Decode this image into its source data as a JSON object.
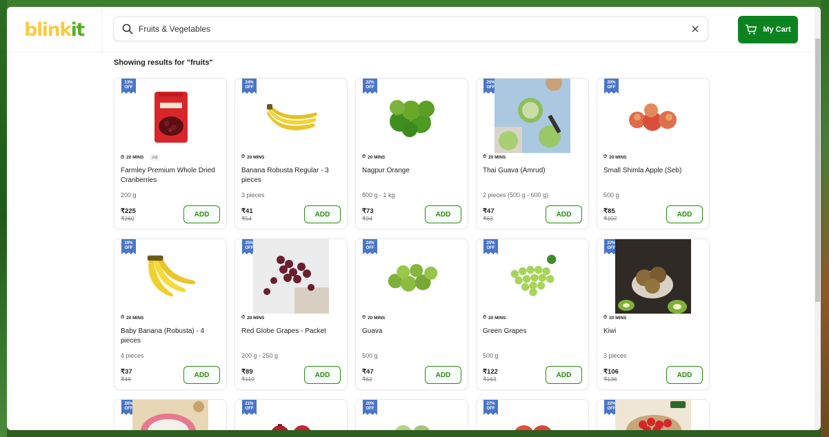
{
  "header": {
    "logo_part1": "blink",
    "logo_part2": "it",
    "search_value": "Fruits & Vegetables",
    "cart_label": "My Cart"
  },
  "results_title": "Showing results for \"fruits\"",
  "products": [
    {
      "discount": "13%\nOFF",
      "eta": "20 MINS",
      "ad": "Ad",
      "name": "Farmley Premium Whole Dried Cranberries",
      "qty": "200 g",
      "price": "₹225",
      "mrp": "₹260",
      "add": "ADD",
      "image": "cranberry-pack"
    },
    {
      "discount": "24%\nOFF",
      "eta": "20 MINS",
      "name": "Banana Robusta Regular - 3 pieces",
      "qty": "3 pieces",
      "price": "₹41",
      "mrp": "₹54",
      "add": "ADD",
      "image": "banana"
    },
    {
      "discount": "22%\nOFF",
      "eta": "20 MINS",
      "name": "Nagpur Orange",
      "qty": "800 g - 1 kg",
      "price": "₹73",
      "mrp": "₹94",
      "add": "ADD",
      "image": "orange"
    },
    {
      "discount": "25%\nOFF",
      "eta": "20 MINS",
      "name": "Thai Guava (Amrud)",
      "qty": "2 pieces (500 g - 600 g)",
      "price": "₹47",
      "mrp": "₹63",
      "add": "ADD",
      "image": "thai-guava"
    },
    {
      "discount": "20%\nOFF",
      "eta": "20 MINS",
      "name": "Small Shimla Apple (Seb)",
      "qty": "500 g",
      "price": "₹85",
      "mrp": "₹107",
      "add": "ADD",
      "image": "apple"
    },
    {
      "discount": "19%\nOFF",
      "eta": "20 MINS",
      "name": "Baby Banana (Robusta) - 4 pieces",
      "qty": "4 pieces",
      "price": "₹37",
      "mrp": "₹46",
      "add": "ADD",
      "image": "baby-banana"
    },
    {
      "discount": "25%\nOFF",
      "eta": "20 MINS",
      "name": "Red Globe Grapes - Packet",
      "qty": "200 g - 250 g",
      "price": "₹89",
      "mrp": "₹119",
      "add": "ADD",
      "image": "red-grapes"
    },
    {
      "discount": "24%\nOFF",
      "eta": "20 MINS",
      "name": "Guava",
      "qty": "500 g",
      "price": "₹47",
      "mrp": "₹62",
      "add": "ADD",
      "image": "guava"
    },
    {
      "discount": "25%\nOFF",
      "eta": "20 MINS",
      "name": "Green Grapes",
      "qty": "500 g",
      "price": "₹122",
      "mrp": "₹163",
      "add": "ADD",
      "image": "green-grapes"
    },
    {
      "discount": "22%\nOFF",
      "eta": "20 MINS",
      "name": "Kiwi",
      "qty": "3 pieces",
      "price": "₹106",
      "mrp": "₹136",
      "add": "ADD",
      "image": "kiwi"
    }
  ],
  "partial_row": [
    {
      "discount": "26%\nOFF",
      "image": "dragon-fruit"
    },
    {
      "discount": "21%\nOFF",
      "image": "pomegranate"
    },
    {
      "discount": "20%\nOFF",
      "image": "custard-apple"
    },
    {
      "discount": "27%\nOFF",
      "image": "red-apple"
    },
    {
      "discount": "22%\nOFF",
      "image": "strawberry"
    }
  ],
  "colors": {
    "brand_yellow": "#f8cb46",
    "brand_green": "#54b226",
    "cart_green": "#0c831f",
    "add_green": "#318616",
    "badge_blue": "#4a75c8"
  }
}
